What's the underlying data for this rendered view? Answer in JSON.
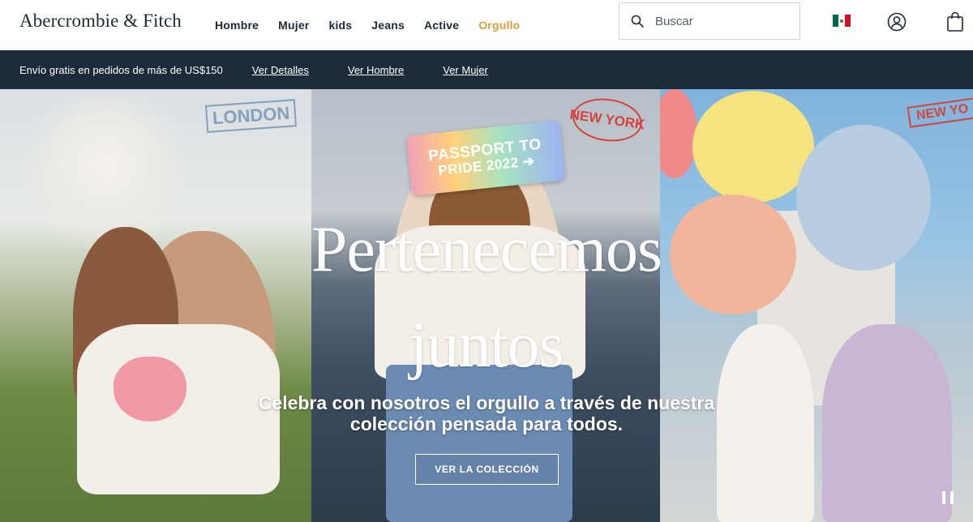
{
  "brand": {
    "logo_text": "Abercrombie & Fitch"
  },
  "nav": {
    "items": [
      {
        "label": "Hombre"
      },
      {
        "label": "Mujer"
      },
      {
        "label": "kids"
      },
      {
        "label": "Jeans"
      },
      {
        "label": "Active"
      },
      {
        "label": "Orgullo"
      }
    ],
    "pride_color": "#d6a13c"
  },
  "search": {
    "placeholder": "Buscar",
    "icon": "search-icon"
  },
  "header_icons": {
    "flag": "mexico-flag-icon",
    "account": "account-icon",
    "bag": "shopping-bag-icon"
  },
  "promo": {
    "text": "Envío gratis en pedidos de más de US$150",
    "links": [
      {
        "label": "Ver Detalles"
      },
      {
        "label": "Ver Hombre"
      },
      {
        "label": "Ver Mujer"
      }
    ],
    "background": "#1c2a3a"
  },
  "hero": {
    "stamps": {
      "london": "LONDON",
      "new_york": "NEW YORK",
      "new_york_2": "NEW YO"
    },
    "passport": {
      "line1": "PASSPORT TO",
      "line2": "PRIDE 2022 ➔"
    },
    "headline_line1": "Pertenecemos",
    "headline_line2": "juntos",
    "subline_line1": "Celebra con nosotros el orgullo a través de nuestra",
    "subline_line2": "colección pensada para todos.",
    "cta_label": "VER LA COLECCIÓN",
    "pause_icon": "pause-icon"
  }
}
